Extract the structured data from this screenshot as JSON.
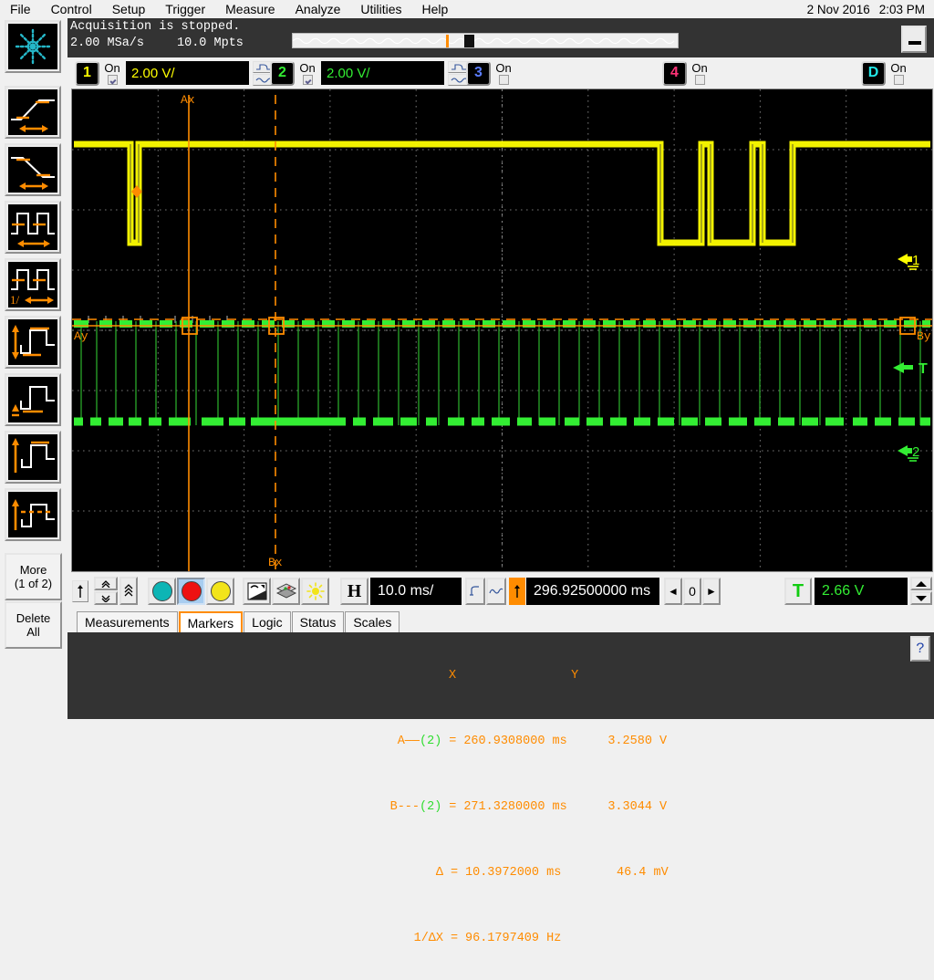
{
  "menu": {
    "items": [
      "File",
      "Control",
      "Setup",
      "Trigger",
      "Measure",
      "Analyze",
      "Utilities",
      "Help"
    ],
    "date": "2 Nov 2016",
    "time": "2:03 PM"
  },
  "acquisition": {
    "status": "Acquisition is stopped.",
    "sample_rate": "2.00 MSa/s",
    "memory_depth": "10.0 Mpts"
  },
  "window": {
    "minimize_label": "minimize"
  },
  "channels": [
    {
      "id": "1",
      "label": "1",
      "color": "#ffff00",
      "on_label": "On",
      "enabled": true,
      "vdiv": "2.00 V/"
    },
    {
      "id": "2",
      "label": "2",
      "color": "#33ee33",
      "on_label": "On",
      "enabled": true,
      "vdiv": "2.00 V/"
    },
    {
      "id": "3",
      "label": "3",
      "color": "#5b7dff",
      "on_label": "On",
      "enabled": false,
      "vdiv": ""
    },
    {
      "id": "4",
      "label": "4",
      "color": "#ff3377",
      "on_label": "On",
      "enabled": false,
      "vdiv": ""
    },
    {
      "id": "D",
      "label": "D",
      "color": "#22e8e8",
      "on_label": "On",
      "enabled": false,
      "vdiv": ""
    }
  ],
  "sidebar": {
    "buttons": [
      {
        "name": "logo",
        "icon": "starburst-icon"
      },
      {
        "name": "rise-time",
        "icon": "rising-edge-icon"
      },
      {
        "name": "fall-time",
        "icon": "falling-edge-icon"
      },
      {
        "name": "period",
        "icon": "period-icon"
      },
      {
        "name": "frequency",
        "icon": "frequency-icon"
      },
      {
        "name": "amplitude",
        "icon": "amplitude-icon"
      },
      {
        "name": "base",
        "icon": "base-icon"
      },
      {
        "name": "peak-to-peak",
        "icon": "peak-to-peak-icon"
      },
      {
        "name": "average",
        "icon": "average-icon"
      }
    ],
    "more_line1": "More",
    "more_line2": "(1 of 2)",
    "delete_line1": "Delete",
    "delete_line2": "All"
  },
  "display": {
    "marker_a_label": "Ax",
    "marker_b_label": "Bx",
    "marker_ay_label": "Ay",
    "marker_by_label": "By",
    "ch1_ground_label": "1",
    "ch2_ground_label": "2",
    "trigger_label": "T"
  },
  "timebase": {
    "h_label": "H",
    "time_per_div": "10.0 ms/",
    "delay": "296.92500000 ms",
    "delay_counter": "0",
    "prev_label": "◄",
    "next_label": "►"
  },
  "trigger": {
    "badge": "T",
    "level": "2.66 V"
  },
  "tabs": [
    {
      "label": "Measurements",
      "selected": false
    },
    {
      "label": "Markers",
      "selected": true
    },
    {
      "label": "Logic",
      "selected": false
    },
    {
      "label": "Status",
      "selected": false
    },
    {
      "label": "Scales",
      "selected": false
    }
  ],
  "markers": {
    "col_x": "X",
    "col_y": "Y",
    "rows": [
      {
        "label": "A——",
        "source": "(2)",
        "eq": "=",
        "x": "260.9308000 ms",
        "y": "3.2580 V"
      },
      {
        "label": "B---",
        "source": "(2)",
        "eq": "=",
        "x": "271.3280000 ms",
        "y": "3.3044 V"
      },
      {
        "label": "Δ",
        "source": "",
        "eq": "=",
        "x": "10.3972000 ms",
        "y": "46.4 mV"
      },
      {
        "label": "1/ΔX",
        "source": "",
        "eq": "=",
        "x": "96.1797409 Hz",
        "y": ""
      }
    ]
  },
  "help": {
    "label": "?"
  },
  "colors": {
    "ch1": "#ffff00",
    "ch2": "#33ee33",
    "marker": "#ff8c00",
    "background": "#000000",
    "graticule": "#8a8a8a"
  }
}
